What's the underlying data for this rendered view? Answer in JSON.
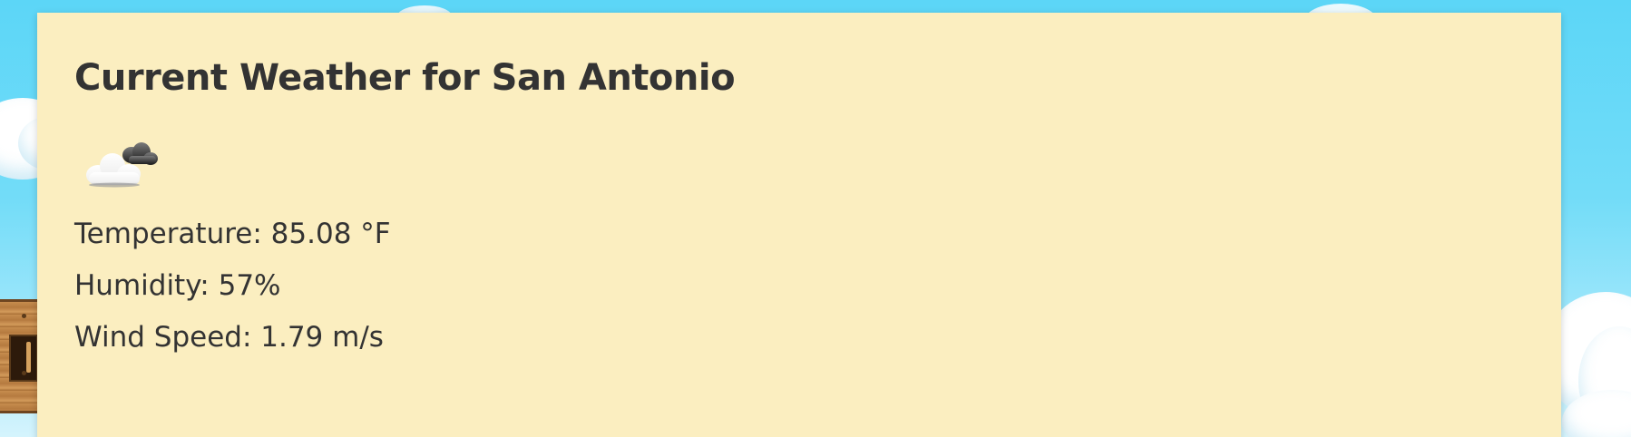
{
  "page": {
    "background_color": "#6ad9f7",
    "card_color": "#fbeec0",
    "text_color": "#333333"
  },
  "weather": {
    "title": "Current Weather for San Antonio",
    "icon": "cloudy-icon",
    "temperature_text": "Temperature: 85.08 °F",
    "humidity_text": "Humidity: 57%",
    "wind_text": "Wind Speed: 1.79 m/s"
  }
}
